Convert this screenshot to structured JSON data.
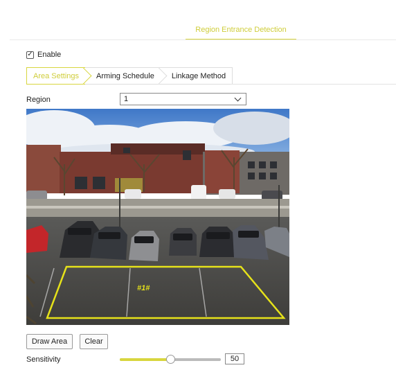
{
  "header": {
    "tab_title": "Region Entrance Detection"
  },
  "enable": {
    "label": "Enable",
    "checked": true
  },
  "subtabs": [
    {
      "label": "Area Settings",
      "active": true
    },
    {
      "label": "Arming Schedule",
      "active": false
    },
    {
      "label": "Linkage Method",
      "active": false
    }
  ],
  "region": {
    "label": "Region",
    "selected": "1"
  },
  "camera": {
    "region_tag": "#1#",
    "region_color": "#e6e21a"
  },
  "buttons": {
    "draw_area": "Draw Area",
    "clear": "Clear"
  },
  "sensitivity": {
    "label": "Sensitivity",
    "value": "50",
    "percent": 50
  },
  "colors": {
    "accent": "#d8d63e",
    "accent_text": "#cfcd3a"
  }
}
